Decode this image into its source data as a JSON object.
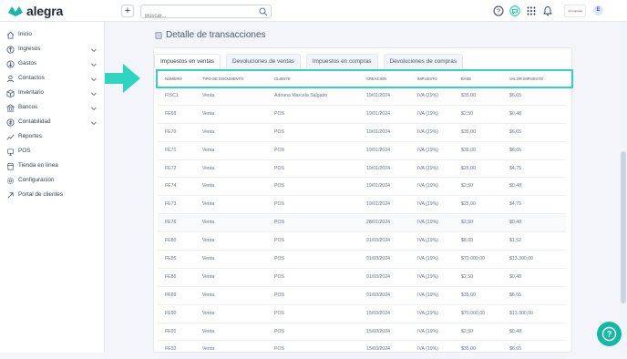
{
  "app": {
    "name": "alegra"
  },
  "header": {
    "search_placeholder": "Buscar...",
    "company_label": "mi empresa",
    "avatar_initial": "E"
  },
  "sidebar": {
    "items": [
      {
        "label": "Inicio",
        "icon": "home-icon",
        "expandable": false
      },
      {
        "label": "Ingresos",
        "icon": "income-icon",
        "expandable": true
      },
      {
        "label": "Gastos",
        "icon": "expenses-icon",
        "expandable": true
      },
      {
        "label": "Contactos",
        "icon": "contacts-icon",
        "expandable": true
      },
      {
        "label": "Inventario",
        "icon": "inventory-icon",
        "expandable": true
      },
      {
        "label": "Bancos",
        "icon": "bank-icon",
        "expandable": true
      },
      {
        "label": "Contabilidad",
        "icon": "accounting-icon",
        "expandable": true
      },
      {
        "label": "Reportes",
        "icon": "reports-icon",
        "expandable": false
      },
      {
        "label": "POS",
        "icon": "pos-icon",
        "expandable": false
      },
      {
        "label": "Tienda en línea",
        "icon": "store-icon",
        "expandable": false
      },
      {
        "label": "Configuración",
        "icon": "settings-icon",
        "expandable": false
      },
      {
        "label": "Portal de clientes",
        "icon": "portal-icon",
        "expandable": false
      }
    ]
  },
  "main": {
    "title": "Detalle de transacciones",
    "tabs": [
      {
        "label": "Impuestos en ventas",
        "active": true
      },
      {
        "label": "Devoluciones de ventas",
        "active": false
      },
      {
        "label": "Impuestos en compras",
        "active": false
      },
      {
        "label": "Devoluciones de compras",
        "active": false
      }
    ],
    "table": {
      "columns": [
        "NÚMERO",
        "TIPO DE DOCUMENTO",
        "CLIENTE",
        "CREACIÓN",
        "IMPUESTO",
        "BASE",
        "VALOR IMPUESTO"
      ],
      "rows": [
        [
          "FISC1",
          "Venta",
          "Adriana Marcela Salgado",
          "19/01/2024",
          "IVA (19%)",
          "$35,00",
          "$6,65"
        ],
        [
          "FE69",
          "Venta",
          "POS",
          "19/01/2024",
          "IVA (19%)",
          "$2,50",
          "$0,48"
        ],
        [
          "FE70",
          "Venta",
          "POS",
          "19/01/2024",
          "IVA (19%)",
          "$35,00",
          "$6,65"
        ],
        [
          "FE71",
          "Venta",
          "POS",
          "19/01/2024",
          "IVA (19%)",
          "$35,00",
          "$6,65"
        ],
        [
          "FE72",
          "Venta",
          "POS",
          "19/01/2024",
          "IVA (19%)",
          "$25,00",
          "$4,75"
        ],
        [
          "FE74",
          "Venta",
          "POS",
          "19/01/2024",
          "IVA (19%)",
          "$2,50",
          "$0,48"
        ],
        [
          "FE73",
          "Venta",
          "POS",
          "19/01/2024",
          "IVA (19%)",
          "$25,00",
          "$4,75"
        ],
        [
          "FE76",
          "Venta",
          "POS",
          "28/01/2024",
          "IVA (19%)",
          "$2,50",
          "$0,48"
        ],
        [
          "FE80",
          "Venta",
          "POS",
          "01/03/2024",
          "IVA (19%)",
          "$8,00",
          "$1,52"
        ],
        [
          "FE85",
          "Venta",
          "POS",
          "01/03/2024",
          "IVA (19%)",
          "$70.000,00",
          "$13.300,00"
        ],
        [
          "FE86",
          "Venta",
          "POS",
          "01/03/2024",
          "IVA (19%)",
          "$2,50",
          "$0,48"
        ],
        [
          "FE89",
          "Venta",
          "POS",
          "01/03/2024",
          "IVA (19%)",
          "$35,00",
          "$6,65"
        ],
        [
          "FE90",
          "Venta",
          "POS",
          "15/03/2024",
          "IVA (19%)",
          "$70.000,00",
          "$13.300,00"
        ],
        [
          "FE91",
          "Venta",
          "POS",
          "15/03/2024",
          "IVA (19%)",
          "$2,50",
          "$0,48"
        ],
        [
          "FE92",
          "Venta",
          "POS",
          "15/03/2024",
          "IVA (19%)",
          "$35,00",
          "$6,65"
        ]
      ]
    }
  },
  "colors": {
    "accent": "#14b8a6",
    "highlight": "#2dd4bf",
    "hover_row": "#f8fafc"
  }
}
